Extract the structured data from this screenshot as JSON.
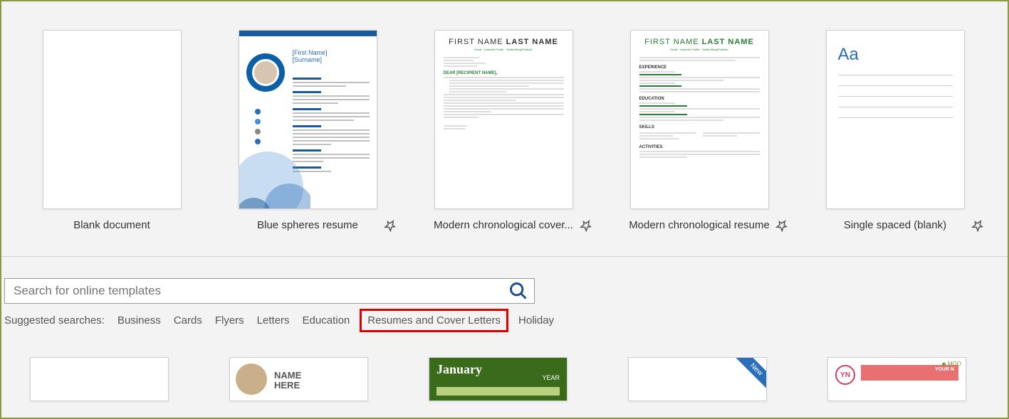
{
  "templates": [
    {
      "title": "Blank document",
      "pinned": false
    },
    {
      "title": "Blue spheres resume",
      "pinned": true
    },
    {
      "title": "Modern chronological cover...",
      "pinned": true
    },
    {
      "title": "Modern chronological resume",
      "pinned": true
    },
    {
      "title": "Single spaced (blank)",
      "pinned": true
    }
  ],
  "thumb2": {
    "first": "[First Name]",
    "last": "[Surname]"
  },
  "thumb3": {
    "name_first": "FIRST NAME",
    "name_last": "LAST NAME",
    "greeting": "DEAR [RECIPIENT NAME],"
  },
  "thumb4": {
    "name_first": "FIRST NAME",
    "name_last": "LAST NAME",
    "sec1": "EXPERIENCE",
    "sec2": "EDUCATION",
    "sec3": "SKILLS",
    "sec4": "ACTIVITIES"
  },
  "thumb5": {
    "aa": "Aa"
  },
  "search": {
    "placeholder": "Search for online templates"
  },
  "suggested": {
    "label": "Suggested searches:",
    "items": [
      "Business",
      "Cards",
      "Flyers",
      "Letters",
      "Education",
      "Resumes and Cover Letters",
      "Holiday"
    ],
    "highlighted_index": 5
  },
  "bottom": {
    "t2_name": "NAME\nHERE",
    "t3_month": "January",
    "t3_year": "YEAR",
    "t4_ribbon": "New",
    "t5_initials": "YN",
    "t5_title": "YOUR N",
    "t5_moo": "MOO"
  }
}
